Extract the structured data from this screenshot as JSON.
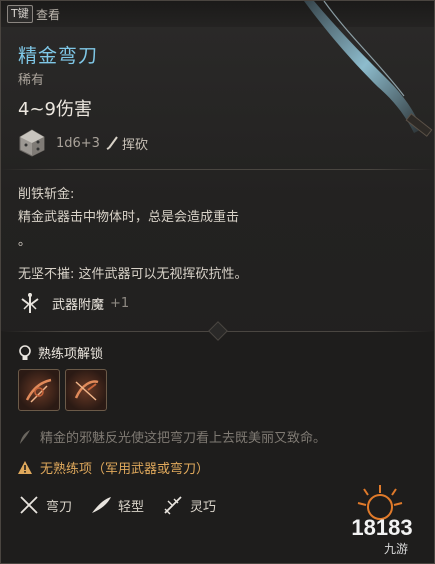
{
  "topbar": {
    "key": "T键",
    "action": "查看"
  },
  "item": {
    "name": "精金弯刀",
    "rarity": "稀有",
    "damage": "4~9伤害",
    "dice": "1d6+3",
    "damage_type": "挥砍"
  },
  "passives": {
    "title": "削铁斩金:",
    "desc_line1": "精金武器击中物体时，总是会造成重击",
    "desc_line2": "。",
    "second": "无坚不摧: 这件武器可以无视挥砍抗性。"
  },
  "enchant": {
    "label": "武器附魔",
    "bonus": "+1"
  },
  "proficiency": {
    "label": "熟练项解锁"
  },
  "flavor": "精金的邪魅反光使这把弯刀看上去既美丽又致命。",
  "warning": "无熟练项（军用武器或弯刀）",
  "tags": [
    {
      "icon": "crossed-swords-icon",
      "label": "弯刀"
    },
    {
      "icon": "feather-icon",
      "label": "轻型"
    },
    {
      "icon": "finesse-icon",
      "label": "灵巧"
    }
  ],
  "watermark": {
    "text": "18183"
  },
  "colors": {
    "item_name": "#7fc7e6",
    "warning": "#e0a95c",
    "flavor": "#7f7a73"
  }
}
